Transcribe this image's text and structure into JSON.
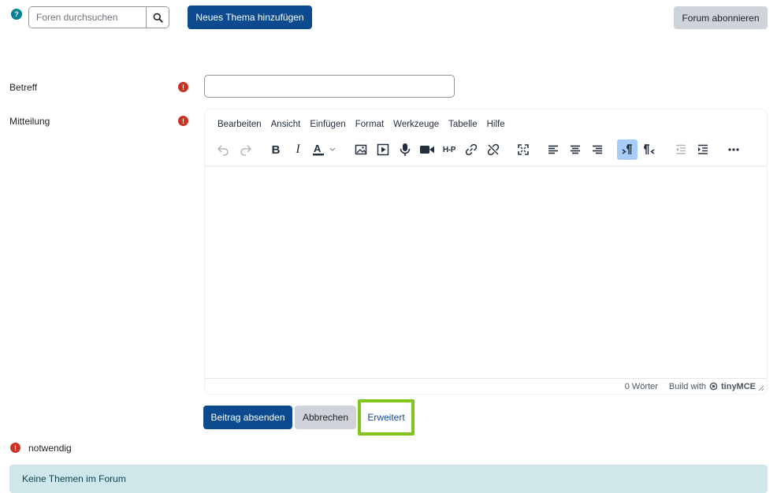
{
  "topbar": {
    "help_icon": "question-icon",
    "search_placeholder": "Foren durchsuchen",
    "search_icon": "search-icon",
    "new_topic_label": "Neues Thema hinzufügen",
    "subscribe_label": "Forum abonnieren"
  },
  "form": {
    "subject_label": "Betreff",
    "subject_value": "",
    "message_label": "Mitteilung",
    "required_icon": "exclamation-icon"
  },
  "editor": {
    "menu": [
      "Bearbeiten",
      "Ansicht",
      "Einfügen",
      "Format",
      "Werkzeuge",
      "Tabelle",
      "Hilfe"
    ],
    "toolbar": [
      "undo-icon",
      "redo-icon",
      "bold-icon",
      "italic-icon",
      "text-color-icon",
      "image-icon",
      "media-icon",
      "record-audio-icon",
      "record-video-icon",
      "h5p-icon",
      "link-icon",
      "unlink-icon",
      "fullscreen-icon",
      "align-left-icon",
      "align-center-icon",
      "align-right-icon",
      "ltr-icon",
      "rtl-icon",
      "outdent-icon",
      "indent-icon",
      "more-icon"
    ],
    "word_count": "0 Wörter",
    "build_with": "Build with",
    "brand": "tinyMCE"
  },
  "actions": {
    "submit_label": "Beitrag absenden",
    "cancel_label": "Abbrechen",
    "advanced_label": "Erweitert"
  },
  "legend": {
    "required_text": "notwendig"
  },
  "notice": {
    "text": "Keine Themen im Forum"
  },
  "colors": {
    "primary": "#0b4a8f",
    "required": "#ca3120",
    "highlight": "#84c51b",
    "notice_bg": "#cfe7ea"
  }
}
